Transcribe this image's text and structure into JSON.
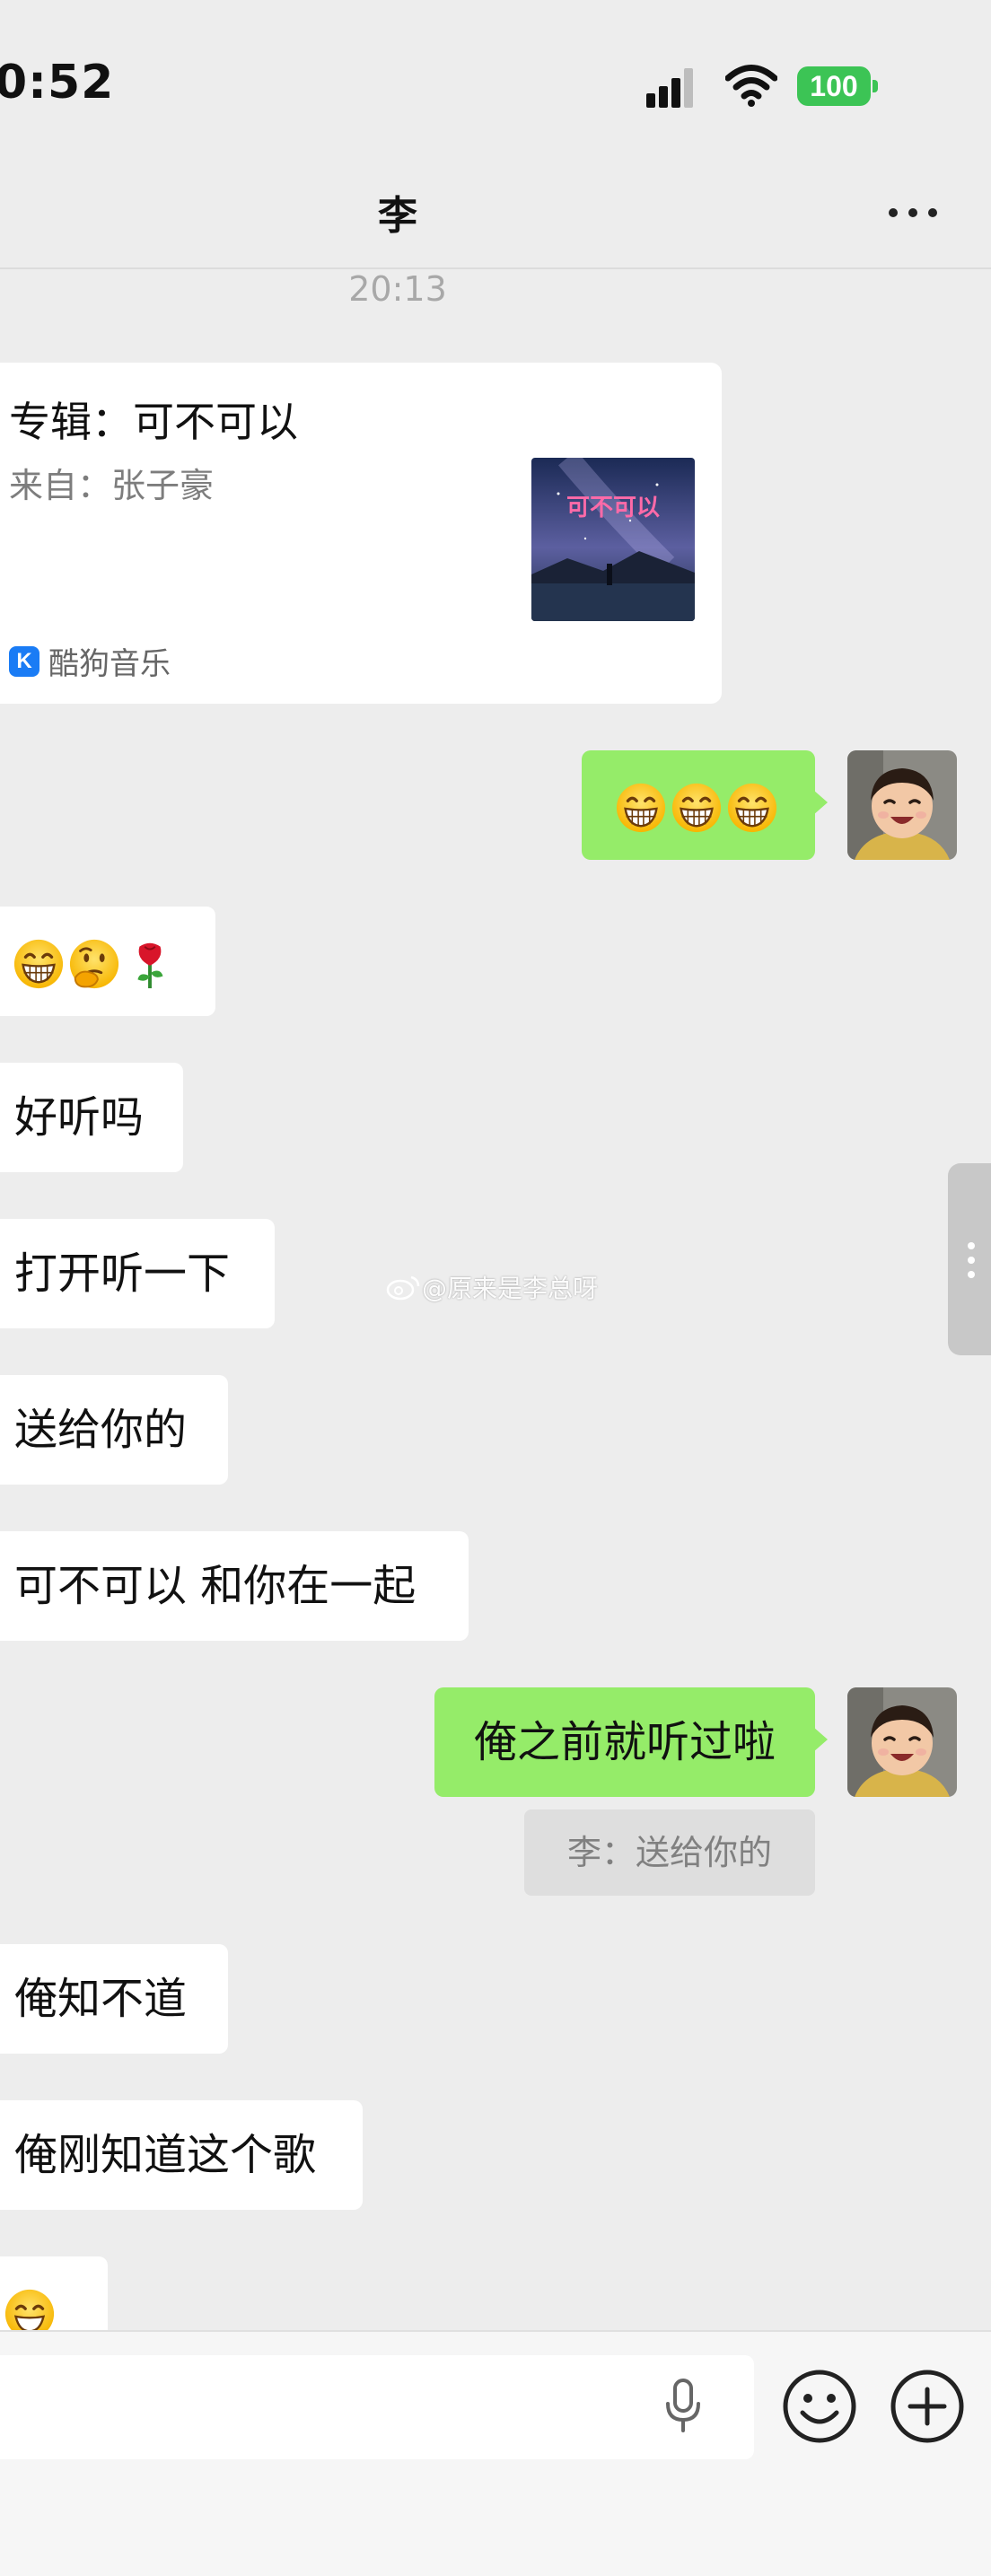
{
  "status_bar": {
    "time": "0:52",
    "battery": "100"
  },
  "header": {
    "title": "李"
  },
  "chat": {
    "timestamp": "20:13",
    "music_card": {
      "title": "专辑：可不可以",
      "artist_line": "来自：张子豪",
      "cover_text": "可不可以",
      "source": "酷狗音乐"
    },
    "messages": [
      {
        "side": "sent",
        "emojis": [
          "grin",
          "grin",
          "grin"
        ]
      },
      {
        "side": "received",
        "emojis": [
          "grin",
          "thinking",
          "rose"
        ]
      },
      {
        "side": "received",
        "text": "好听吗"
      },
      {
        "side": "received",
        "text": "打开听一下"
      },
      {
        "side": "received",
        "text": "送给你的"
      },
      {
        "side": "received",
        "text": "可不可以 和你在一起"
      },
      {
        "side": "sent",
        "text": "俺之前就听过啦",
        "quote": "李：送给你的"
      },
      {
        "side": "received",
        "text": "俺知不道"
      },
      {
        "side": "received",
        "text": "俺刚知道这个歌"
      },
      {
        "side": "received",
        "emojis": [
          "smile"
        ]
      }
    ]
  },
  "watermark": "@原来是李总呀",
  "colors": {
    "sent_bubble": "#95ec69",
    "received_bubble": "#ffffff",
    "background": "#ededed",
    "battery": "#3cc455"
  }
}
